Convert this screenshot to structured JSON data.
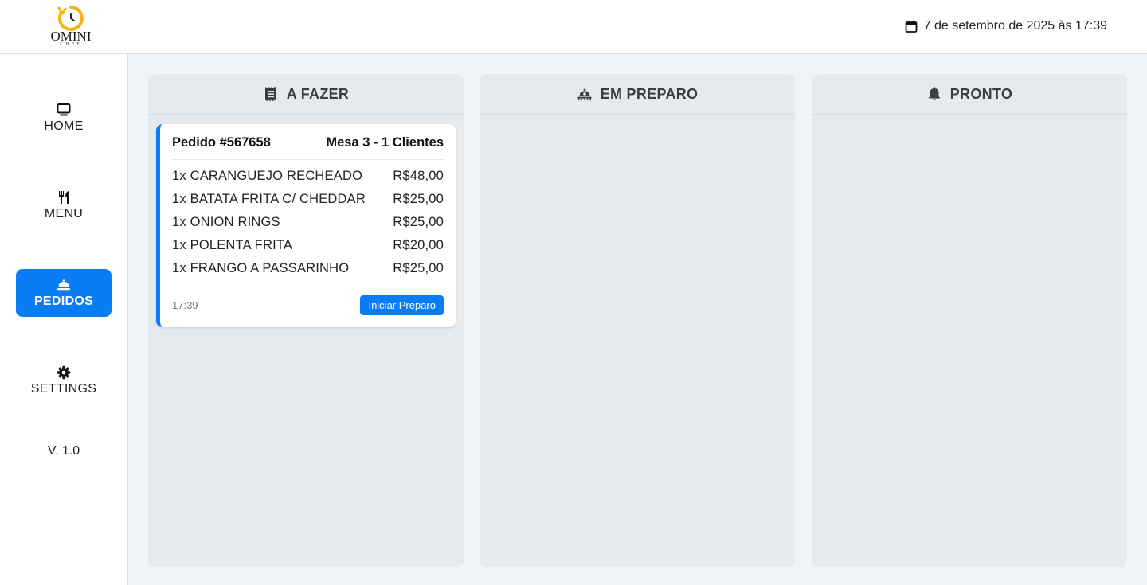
{
  "brand": {
    "name": "OMINI",
    "sub": "CHEF"
  },
  "header": {
    "datetime": "7 de setembro de 2025 às 17:39"
  },
  "sidebar": {
    "items": [
      {
        "label": "HOME",
        "icon": "monitor-icon"
      },
      {
        "label": "MENU",
        "icon": "utensils-icon"
      },
      {
        "label": "PEDIDOS",
        "icon": "bell-concierge-icon",
        "active": true
      },
      {
        "label": "SETTINGS",
        "icon": "gear-icon"
      }
    ],
    "version": "V. 1.0"
  },
  "board": {
    "columns": [
      {
        "title": "A FAZER",
        "icon": "receipt-icon"
      },
      {
        "title": "EM PREPARO",
        "icon": "chef-cooking-icon"
      },
      {
        "title": "PRONTO",
        "icon": "bell-icon"
      }
    ]
  },
  "order": {
    "number": "Pedido #567658",
    "table": "Mesa 3 - 1 Clientes",
    "items": [
      {
        "name": "1x CARANGUEJO RECHEADO",
        "price": "R$48,00"
      },
      {
        "name": "1x BATATA FRITA C/ CHEDDAR",
        "price": "R$25,00"
      },
      {
        "name": "1x ONION RINGS",
        "price": "R$25,00"
      },
      {
        "name": "1x POLENTA FRITA",
        "price": "R$20,00"
      },
      {
        "name": "1x FRANGO A PASSARINHO",
        "price": "R$25,00"
      }
    ],
    "time": "17:39",
    "action": "Iniciar Preparo"
  },
  "colors": {
    "accent": "#0a7cf5",
    "logo": "#f2b417"
  }
}
